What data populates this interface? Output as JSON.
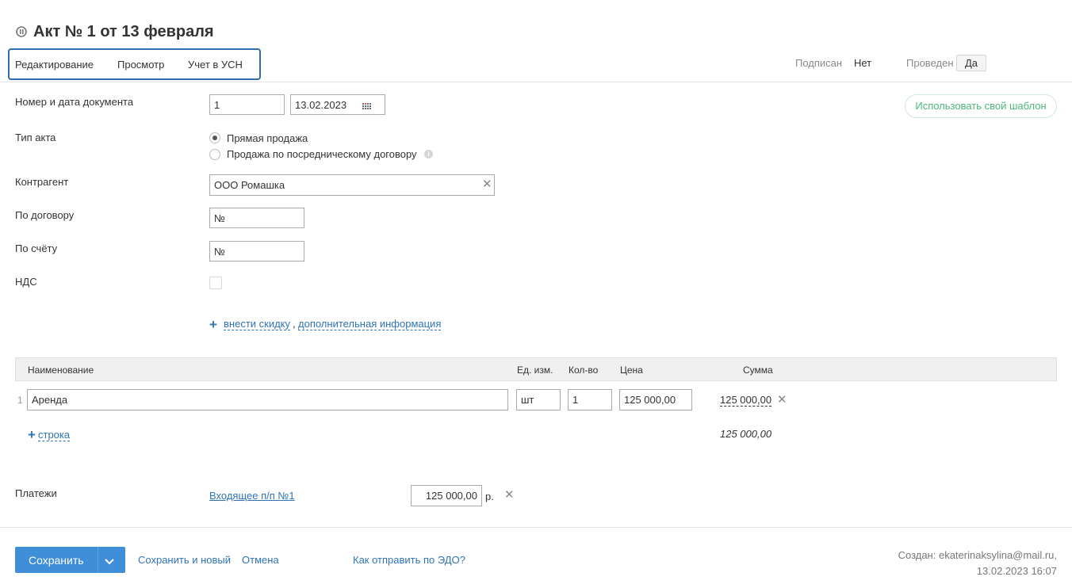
{
  "header": {
    "title": "Акт № 1 от 13 февраля",
    "back_icon": "back-icon",
    "tabs": [
      {
        "label": "Редактирование"
      },
      {
        "label": "Просмотр"
      },
      {
        "label": "Учет в УСН"
      }
    ],
    "signed_label": "Подписан",
    "signed_value": "Нет",
    "posted_label": "Проведен",
    "posted_value": "Да"
  },
  "form": {
    "doc_label": "Номер и дата документа",
    "doc_number": "1",
    "doc_date": "13.02.2023",
    "template_button": "Использовать свой шаблон",
    "act_type_label": "Тип акта",
    "act_type_options": [
      {
        "label": "Прямая продажа",
        "checked": true
      },
      {
        "label": "Продажа по посредническому договору",
        "checked": false
      }
    ],
    "counterparty_label": "Контрагент",
    "counterparty_value": "ООО Ромашка",
    "contract_label": "По договору",
    "contract_placeholder": "№",
    "invoice_label": "По счёту",
    "invoice_placeholder": "№",
    "vat_label": "НДС",
    "vat_checked": false,
    "discount_link": "внести скидку",
    "separator": ",",
    "extra_info_link": "дополнительная информация"
  },
  "table": {
    "columns": [
      "Наименование",
      "Ед. изм.",
      "Кол-во",
      "Цена",
      "Сумма"
    ],
    "rows": [
      {
        "num": "1",
        "name": "Аренда",
        "unit": "шт",
        "qty": "1",
        "price": "125 000,00",
        "sum": "125 000,00"
      }
    ],
    "add_row_link": "строка",
    "total": "125 000,00"
  },
  "payments": {
    "label": "Платежи",
    "link": "Входящее п/п №1",
    "amount": "125 000,00",
    "currency": "р."
  },
  "footer": {
    "save": "Сохранить",
    "save_new": "Сохранить и новый",
    "cancel": "Отмена",
    "edo_link": "Как отправить по ЭДО?",
    "created_by": "Создан: ekaterinaksylina@mail.ru,",
    "created_at": "13.02.2023 16:07"
  },
  "colors": {
    "accent": "#3e8ed8",
    "link": "#2f74b7",
    "tabs_border": "#2f6fb2",
    "template_green": "#4db77a"
  }
}
